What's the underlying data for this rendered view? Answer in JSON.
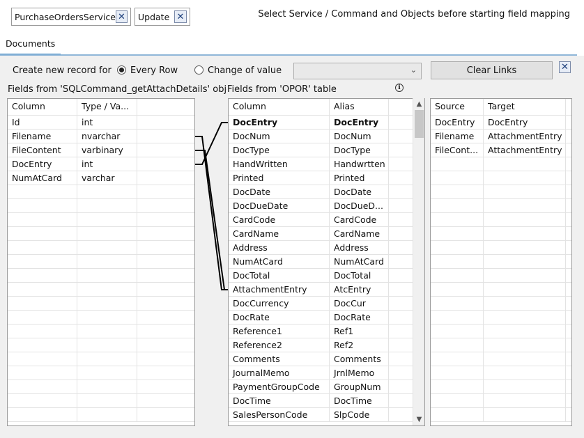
{
  "top": {
    "chips": [
      {
        "label": "PurchaseOrdersService"
      },
      {
        "label": "Update"
      }
    ],
    "hint": "Select Service / Command and Objects before starting field mapping"
  },
  "tabs": [
    {
      "label": "Documents"
    }
  ],
  "options": {
    "create_label": "Create new record for",
    "every_row": "Every Row",
    "change_value": "Change of value",
    "selected": "every_row",
    "combo_value": "",
    "clear_links": "Clear Links"
  },
  "source_grid": {
    "title": "Fields from 'SQLCommand_getAttachDetails' obje",
    "columns": [
      "Column",
      "Type / Va..."
    ],
    "rows": [
      [
        "Id",
        "int"
      ],
      [
        "Filename",
        "nvarchar"
      ],
      [
        "FileContent",
        "varbinary"
      ],
      [
        "DocEntry",
        "int"
      ],
      [
        "NumAtCard",
        "varchar"
      ]
    ]
  },
  "target_grid": {
    "title": "Fields from 'OPOR' table",
    "columns": [
      "Column",
      "Alias"
    ],
    "rows": [
      [
        "DocEntry",
        "DocEntry"
      ],
      [
        "DocNum",
        "DocNum"
      ],
      [
        "DocType",
        "DocType"
      ],
      [
        "HandWritten",
        "Handwrtten"
      ],
      [
        "Printed",
        "Printed"
      ],
      [
        "DocDate",
        "DocDate"
      ],
      [
        "DocDueDate",
        "DocDueD..."
      ],
      [
        "CardCode",
        "CardCode"
      ],
      [
        "CardName",
        "CardName"
      ],
      [
        "Address",
        "Address"
      ],
      [
        "NumAtCard",
        "NumAtCard"
      ],
      [
        "DocTotal",
        "DocTotal"
      ],
      [
        "AttachmentEntry",
        "AtcEntry"
      ],
      [
        "DocCurrency",
        "DocCur"
      ],
      [
        "DocRate",
        "DocRate"
      ],
      [
        "Reference1",
        "Ref1"
      ],
      [
        "Reference2",
        "Ref2"
      ],
      [
        "Comments",
        "Comments"
      ],
      [
        "JournalMemo",
        "JrnlMemo"
      ],
      [
        "PaymentGroupCode",
        "GroupNum"
      ],
      [
        "DocTime",
        "DocTime"
      ],
      [
        "SalesPersonCode",
        "SlpCode"
      ]
    ]
  },
  "mapping_grid": {
    "columns": [
      "Source",
      "Target"
    ],
    "rows": [
      [
        "DocEntry",
        "DocEntry"
      ],
      [
        "Filename",
        "AttachmentEntry"
      ],
      [
        "FileCont...",
        "AttachmentEntry"
      ]
    ]
  },
  "colors": {
    "accent": "#4a90c8",
    "link_line": "#000000"
  }
}
